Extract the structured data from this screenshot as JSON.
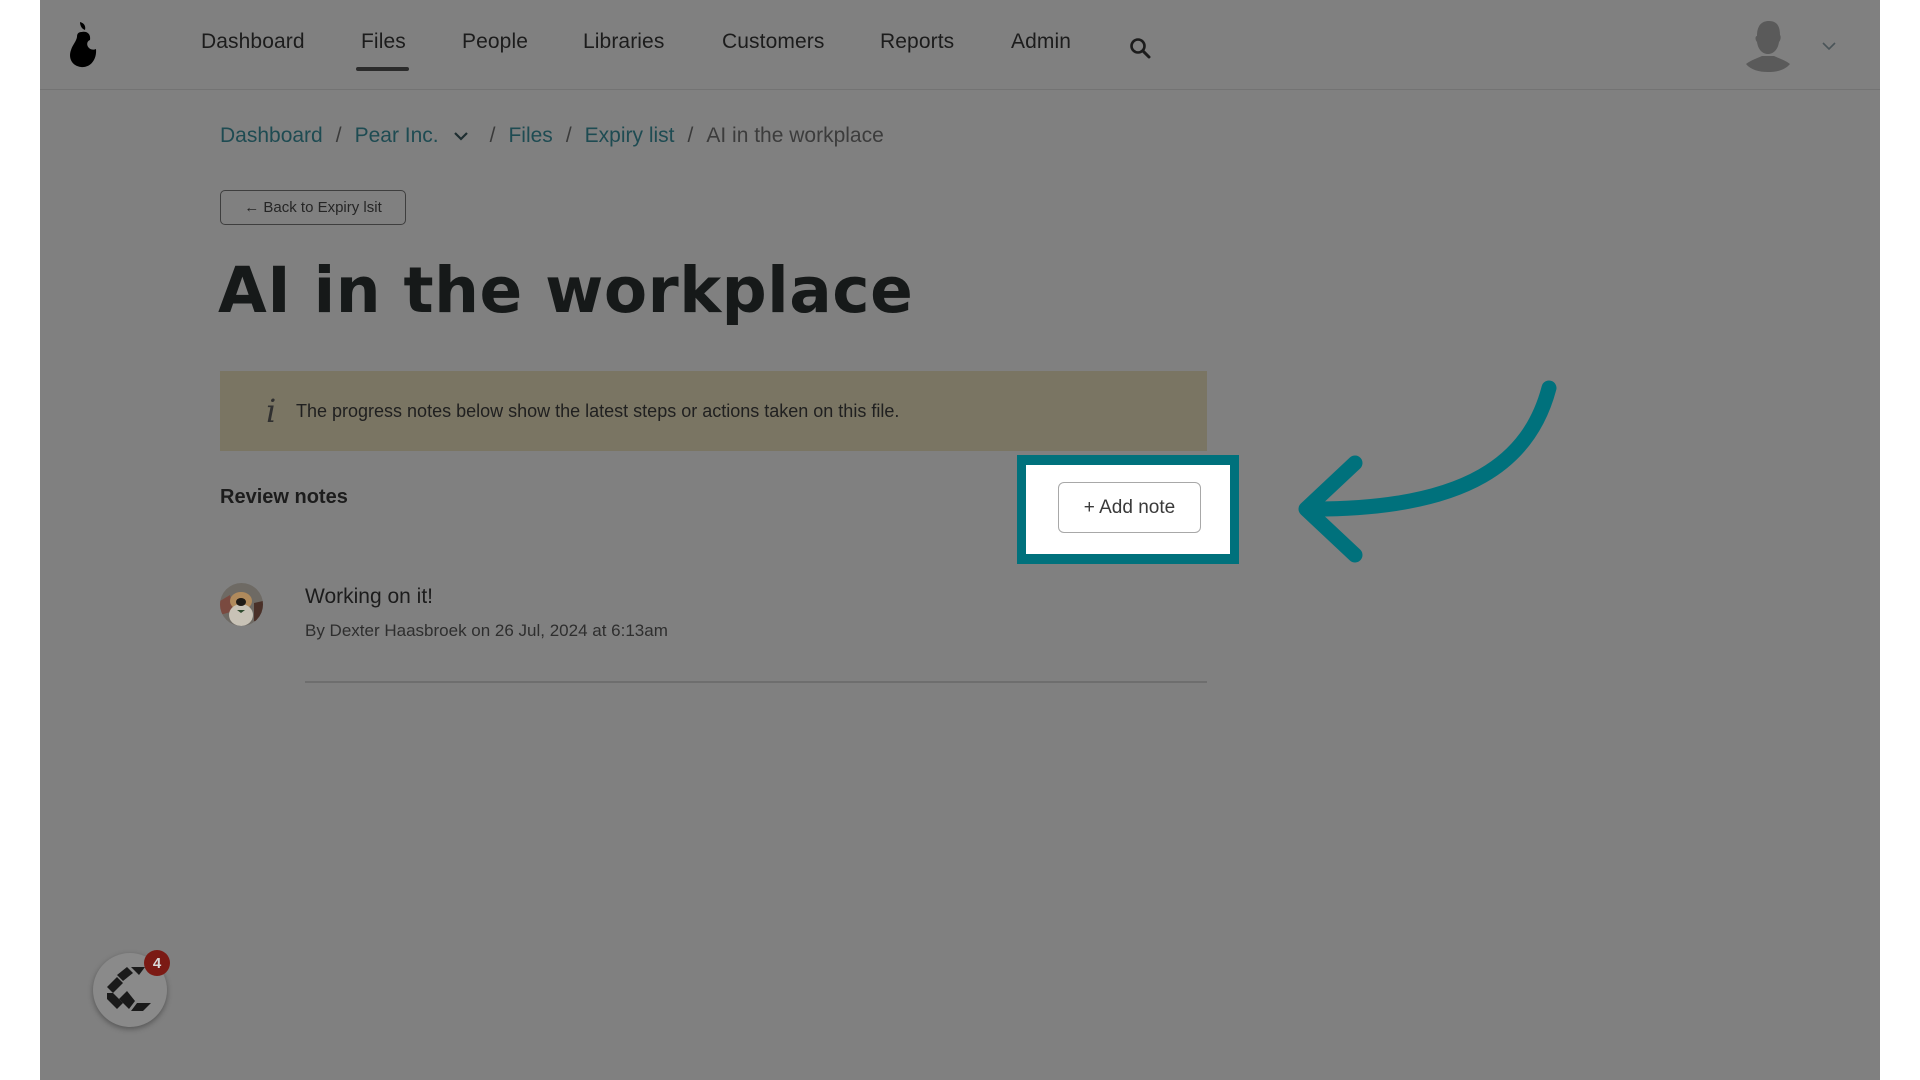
{
  "header": {
    "logo": "pear-logo",
    "nav": [
      {
        "label": "Dashboard",
        "active": false
      },
      {
        "label": "Files",
        "active": true
      },
      {
        "label": "People",
        "active": false
      },
      {
        "label": "Libraries",
        "active": false
      },
      {
        "label": "Customers",
        "active": false
      },
      {
        "label": "Reports",
        "active": false
      },
      {
        "label": "Admin",
        "active": false
      }
    ],
    "search_icon": "search-icon",
    "user_menu_icon": "chevron-down-icon"
  },
  "breadcrumb": {
    "items": [
      {
        "label": "Dashboard"
      },
      {
        "label": "Pear Inc.",
        "dropdown": true
      },
      {
        "label": "Files"
      },
      {
        "label": "Expiry list"
      }
    ],
    "current": "AI in the workplace",
    "separator": "/"
  },
  "back_button": {
    "label": "← Back to Expiry lsit"
  },
  "page": {
    "title": "AI in the workplace"
  },
  "info_banner": {
    "icon": "i",
    "text": "The progress notes below show the latest steps or actions taken on this file."
  },
  "review_notes": {
    "heading": "Review notes",
    "add_button": "+ Add note",
    "notes": [
      {
        "title": "Working on it!",
        "meta": "By Dexter Haasbroek on 26 Jul, 2024 at 6:13am"
      }
    ]
  },
  "help_widget": {
    "badge_count": "4"
  },
  "colors": {
    "overlay": "#808080",
    "accent_teal": "#00717c",
    "banner": "#7a7563",
    "link": "#1e4b52",
    "badge": "#7b1a14"
  }
}
